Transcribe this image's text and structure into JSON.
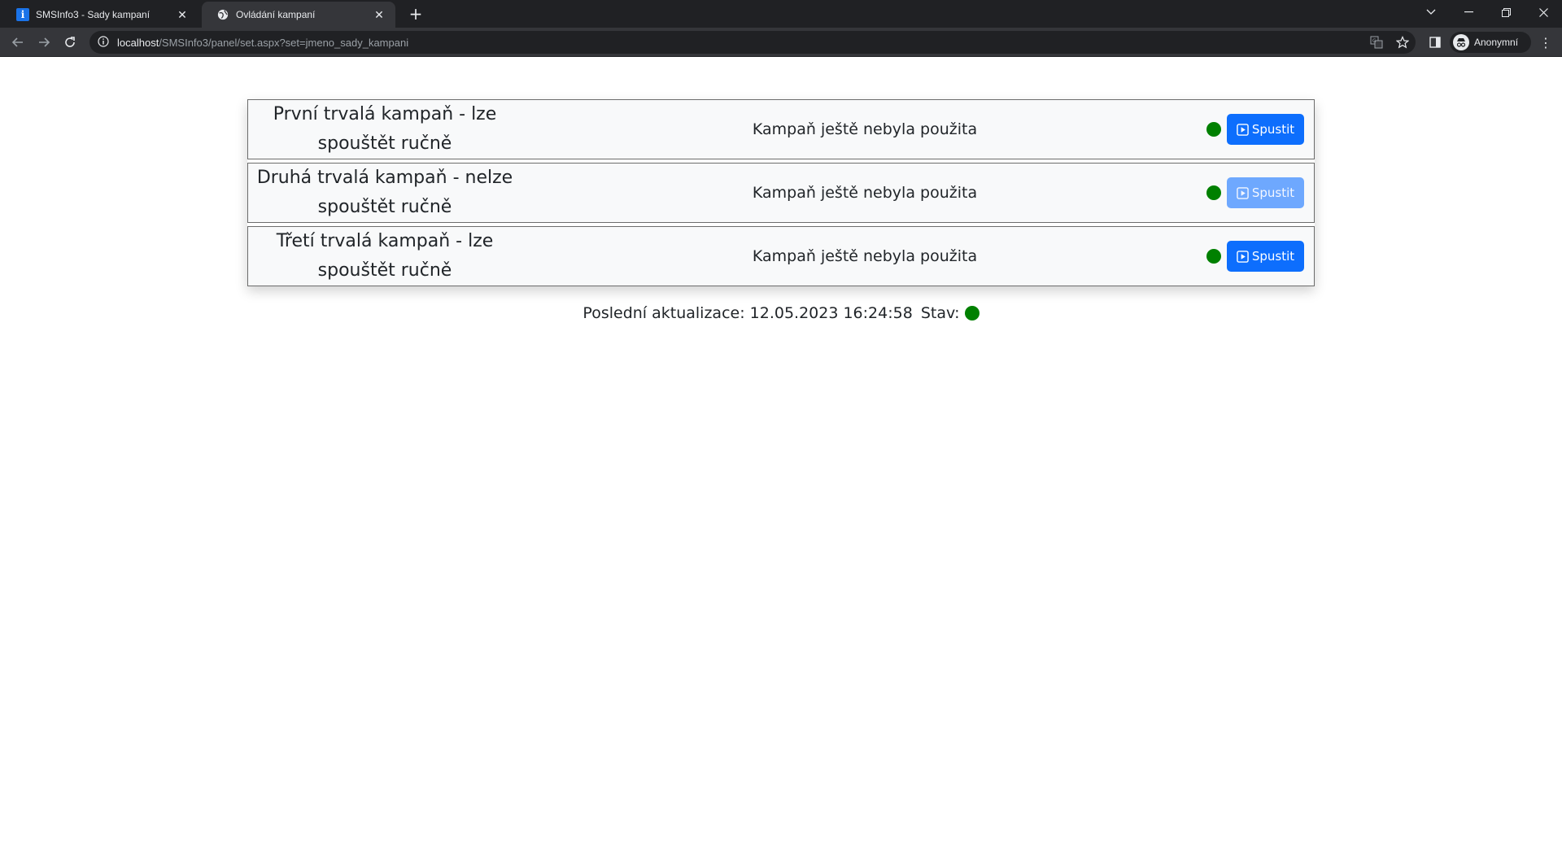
{
  "browser": {
    "tabs": [
      {
        "title": "SMSInfo3 - Sady kampaní",
        "favicon": "info-icon",
        "active": false
      },
      {
        "title": "Ovládání kampaní",
        "favicon": "globe-icon",
        "active": true
      }
    ],
    "address": {
      "host": "localhost",
      "path": "/SMSInfo3/panel/set.aspx?set=jmeno_sady_kampani"
    },
    "profile_name": "Anonymní"
  },
  "campaigns": [
    {
      "name_line1": "První trvalá kampaň - lze",
      "name_line2": "spouštět ručně",
      "status": "Kampaň ještě nebyla použita",
      "button_label": "Spustit",
      "button_enabled": true
    },
    {
      "name_line1": "Druhá trvalá kampaň - nelze",
      "name_line2": "spouštět ručně",
      "status": "Kampaň ještě nebyla použita",
      "button_label": "Spustit",
      "button_enabled": false
    },
    {
      "name_line1": "Třetí trvalá kampaň - lze",
      "name_line2": "spouštět ručně",
      "status": "Kampaň ještě nebyla použita",
      "button_label": "Spustit",
      "button_enabled": true
    }
  ],
  "footer": {
    "last_update_label": "Poslední aktualizace: 12.05.2023 16:24:58",
    "state_label": "Stav:"
  },
  "colors": {
    "status_ok": "#008000",
    "primary": "#0d6efd",
    "primary_disabled": "#6ea8fe"
  }
}
